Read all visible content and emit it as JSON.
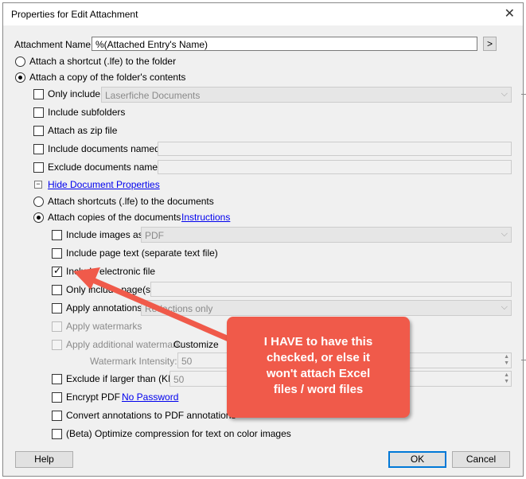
{
  "dialog": {
    "title": "Properties for Edit Attachment"
  },
  "attachment_name": {
    "label": "Attachment Name:",
    "value": "%(Attached Entry's Name)",
    "button": ">"
  },
  "options": {
    "attach_shortcut": "Attach a shortcut (.lfe) to the folder",
    "attach_copy": "Attach a copy of the folder's contents",
    "only_include": "Only include:",
    "only_include_value": "Laserfiche Documents",
    "include_subfolders": "Include subfolders",
    "attach_zip": "Attach as zip file",
    "include_named": "Include documents named:",
    "exclude_named": "Exclude documents named:",
    "hide_props": "Hide Document Properties",
    "attach_shortcuts_docs": "Attach shortcuts (.lfe) to the documents",
    "attach_copies_docs": "Attach copies of the documents",
    "instructions": "Instructions",
    "include_images": "Include images as:",
    "include_images_value": "PDF",
    "include_page_text": "Include page text (separate text file)",
    "include_electronic": "Include electronic file",
    "only_include_pages": "Only include page(s):",
    "apply_annotations": "Apply annotations:",
    "apply_annotations_value": "Redactions only",
    "apply_watermarks": "Apply watermarks",
    "apply_additional": "Apply additional watermark",
    "customize": "Customize",
    "watermark_intensity": "Watermark Intensity:",
    "watermark_value": "50",
    "exclude_larger": "Exclude if larger than (KB):",
    "exclude_larger_value": "50",
    "encrypt_pdf": "Encrypt PDF",
    "no_password": "No Password",
    "convert_annotations": "Convert annotations to PDF annotations",
    "beta_optimize": "(Beta) Optimize compression for text on color images"
  },
  "buttons": {
    "help": "Help",
    "ok": "OK",
    "cancel": "Cancel"
  },
  "callout": {
    "text": "I HAVE to have this\nchecked, or else it\nwon't attach Excel\nfiles / word files",
    "color": "#f05a4a"
  }
}
